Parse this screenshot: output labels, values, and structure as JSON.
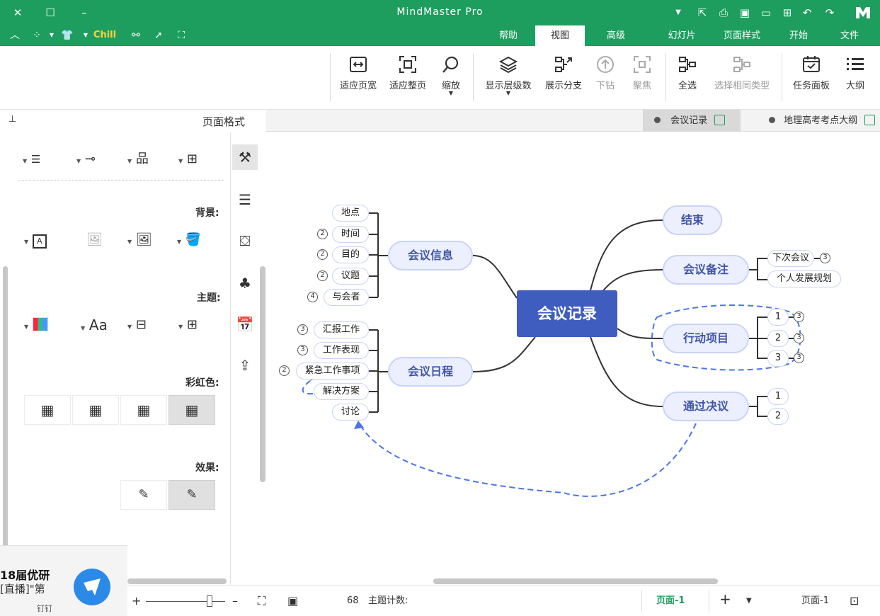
{
  "app": {
    "title": "MindMaster Pro"
  },
  "menu": {
    "tabs": [
      "文件",
      "开始",
      "页面样式",
      "幻灯片",
      "高级",
      "视图",
      "帮助"
    ],
    "active": "视图",
    "theme_label": "Chill"
  },
  "ribbon": {
    "buttons": [
      {
        "label": "大纲",
        "icon": "outline-icon",
        "dim": false
      },
      {
        "label": "任务面板",
        "icon": "task-panel-icon",
        "dim": false
      },
      {
        "label": "选择相同类型",
        "icon": "select-same-type-icon",
        "dim": true
      },
      {
        "label": "全选",
        "icon": "select-all-icon",
        "dim": false
      },
      {
        "label": "聚焦",
        "icon": "focus-icon",
        "dim": true
      },
      {
        "label": "下钻",
        "icon": "drill-down-icon",
        "dim": true
      },
      {
        "label": "展示分支",
        "icon": "show-branch-icon",
        "dim": false
      },
      {
        "label": "显示层级数",
        "icon": "layers-icon",
        "dim": false,
        "dropdown": true
      },
      {
        "label": "缩放",
        "icon": "zoom-icon",
        "dim": false,
        "dropdown": true
      },
      {
        "label": "适应整页",
        "icon": "fit-page-icon",
        "dim": false
      },
      {
        "label": "适应页宽",
        "icon": "fit-width-icon",
        "dim": false
      }
    ]
  },
  "docs": {
    "tabs": [
      {
        "label": "地理高考考点大纲",
        "active": false
      },
      {
        "label": "会议记录",
        "active": true
      }
    ]
  },
  "panel": {
    "title": "页面格式",
    "sections": {
      "background": "背景:",
      "theme": "主题:",
      "rainbow": "彩虹色:",
      "effect": "效果:"
    },
    "theme_font_label": "Aa"
  },
  "mindmap": {
    "central": "会议记录",
    "left_main": [
      {
        "label": "会议信息",
        "children": [
          {
            "label": "地点",
            "badge": ""
          },
          {
            "label": "时间",
            "badge": "2"
          },
          {
            "label": "目的",
            "badge": "2"
          },
          {
            "label": "议题",
            "badge": "2"
          },
          {
            "label": "与会者",
            "badge": "4"
          }
        ]
      },
      {
        "label": "会议日程",
        "children": [
          {
            "label": "汇报工作",
            "badge": "3"
          },
          {
            "label": "工作表现",
            "badge": "3"
          },
          {
            "label": "紧急工作事项",
            "badge": "2"
          },
          {
            "label": "解决方案",
            "badge": ""
          },
          {
            "label": "讨论",
            "badge": ""
          }
        ]
      }
    ],
    "right_main": [
      {
        "label": "结束",
        "children": []
      },
      {
        "label": "会议备注",
        "children": [
          {
            "label": "下次会议",
            "badge": "3"
          },
          {
            "label": "个人发展规划",
            "badge": ""
          }
        ]
      },
      {
        "label": "行动项目",
        "children": [
          {
            "label": "1",
            "badge": "3"
          },
          {
            "label": "2",
            "badge": "3"
          },
          {
            "label": "3",
            "badge": "3"
          }
        ]
      },
      {
        "label": "通过决议",
        "children": [
          {
            "label": "1",
            "badge": ""
          },
          {
            "label": "2",
            "badge": ""
          }
        ]
      }
    ]
  },
  "status": {
    "topic_count_label": "主题计数:",
    "topic_count": "68",
    "page_current": "页面-1",
    "page_tab": "页面-1"
  },
  "notification": {
    "line1": "18届优研",
    "line2": "[直播]\"第",
    "line3": "钉钉"
  },
  "colors": {
    "brand": "#1e9e5e",
    "central": "#3f5cbf",
    "node_fill": "#ecf0fe",
    "dash": "#4d74e8"
  }
}
